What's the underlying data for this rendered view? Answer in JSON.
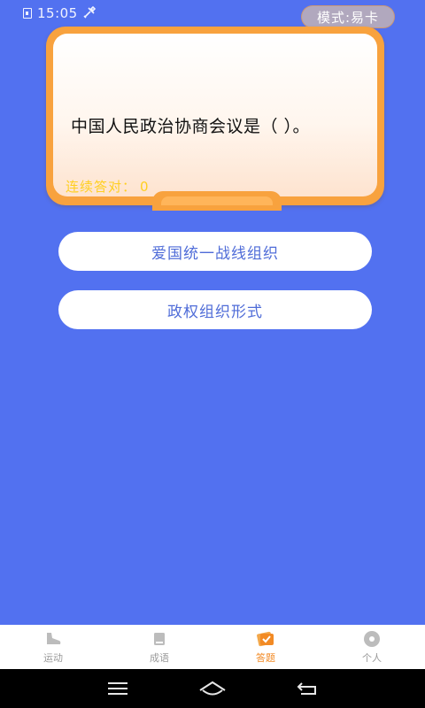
{
  "status_bar": {
    "time": "15:05",
    "tools_icon": "tools-icon"
  },
  "mode_pill": {
    "label": "模式:易卡"
  },
  "question": {
    "text": "中国人民政治协商会议是（ ）。",
    "streak_label": "连续答对：",
    "streak_count": "0"
  },
  "options": [
    {
      "label": "爱国统一战线组织"
    },
    {
      "label": "政权组织形式"
    }
  ],
  "bottom_nav": {
    "items": [
      {
        "label": "运动",
        "icon": "shoe-icon"
      },
      {
        "label": "成语",
        "icon": "book-icon"
      },
      {
        "label": "答题",
        "icon": "quiz-icon",
        "active": true
      },
      {
        "label": "个人",
        "icon": "person-icon"
      }
    ]
  },
  "system_nav": {
    "menu_icon": "menu-icon",
    "home_icon": "home-icon",
    "back_icon": "back-icon"
  },
  "colors": {
    "background": "#5271f0",
    "card_orange": "#f8a23e",
    "streak_yellow": "#ffcf22",
    "option_text": "#4f6cd8",
    "nav_active": "#f28a24"
  }
}
